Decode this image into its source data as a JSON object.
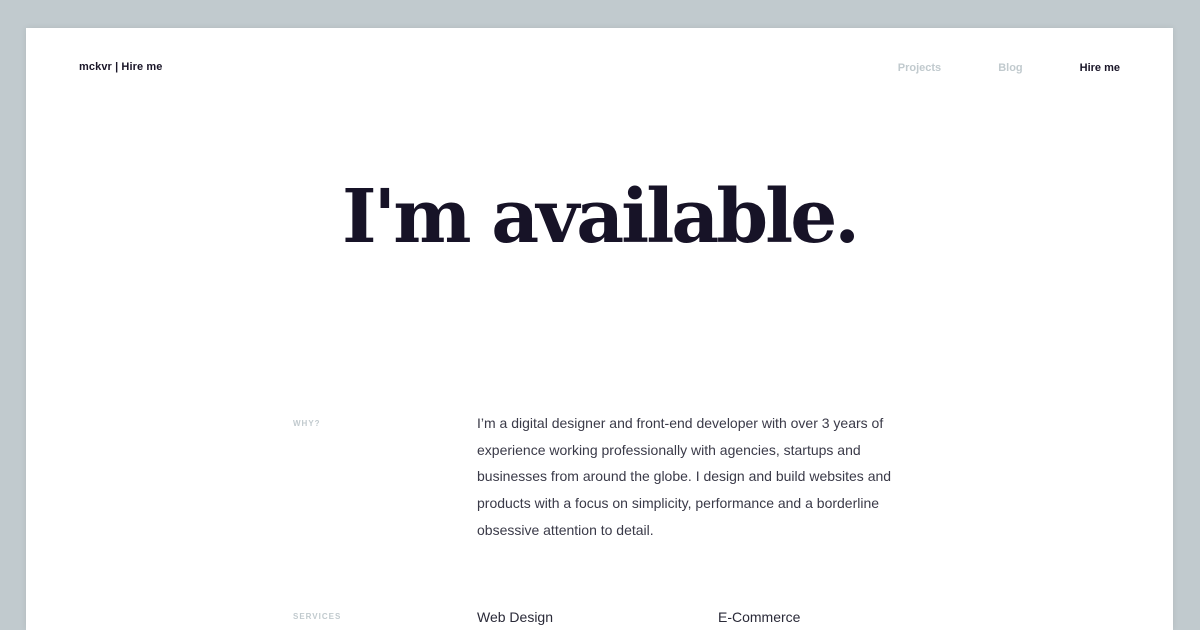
{
  "header": {
    "brand": "mckvr | Hire me",
    "nav": [
      {
        "label": "Projects",
        "active": false
      },
      {
        "label": "Blog",
        "active": false
      },
      {
        "label": "Hire me",
        "active": true
      }
    ]
  },
  "hero": {
    "title": "I'm available."
  },
  "why": {
    "label": "WHY?",
    "text": "I’m a digital designer and front-end developer with over 3 years of experience working professionally with agencies, startups and businesses from around the globe. I design and build websites and products with a focus on simplicity, performance and a borderline obsessive attention to detail."
  },
  "services": {
    "label": "SERVICES",
    "items": [
      "Web Design",
      "E-Commerce"
    ]
  },
  "colors": {
    "background": "#c1cace",
    "page": "#ffffff",
    "text_dark": "#1a1628",
    "text_muted": "#c1cace",
    "body_text": "#3a3a48"
  }
}
